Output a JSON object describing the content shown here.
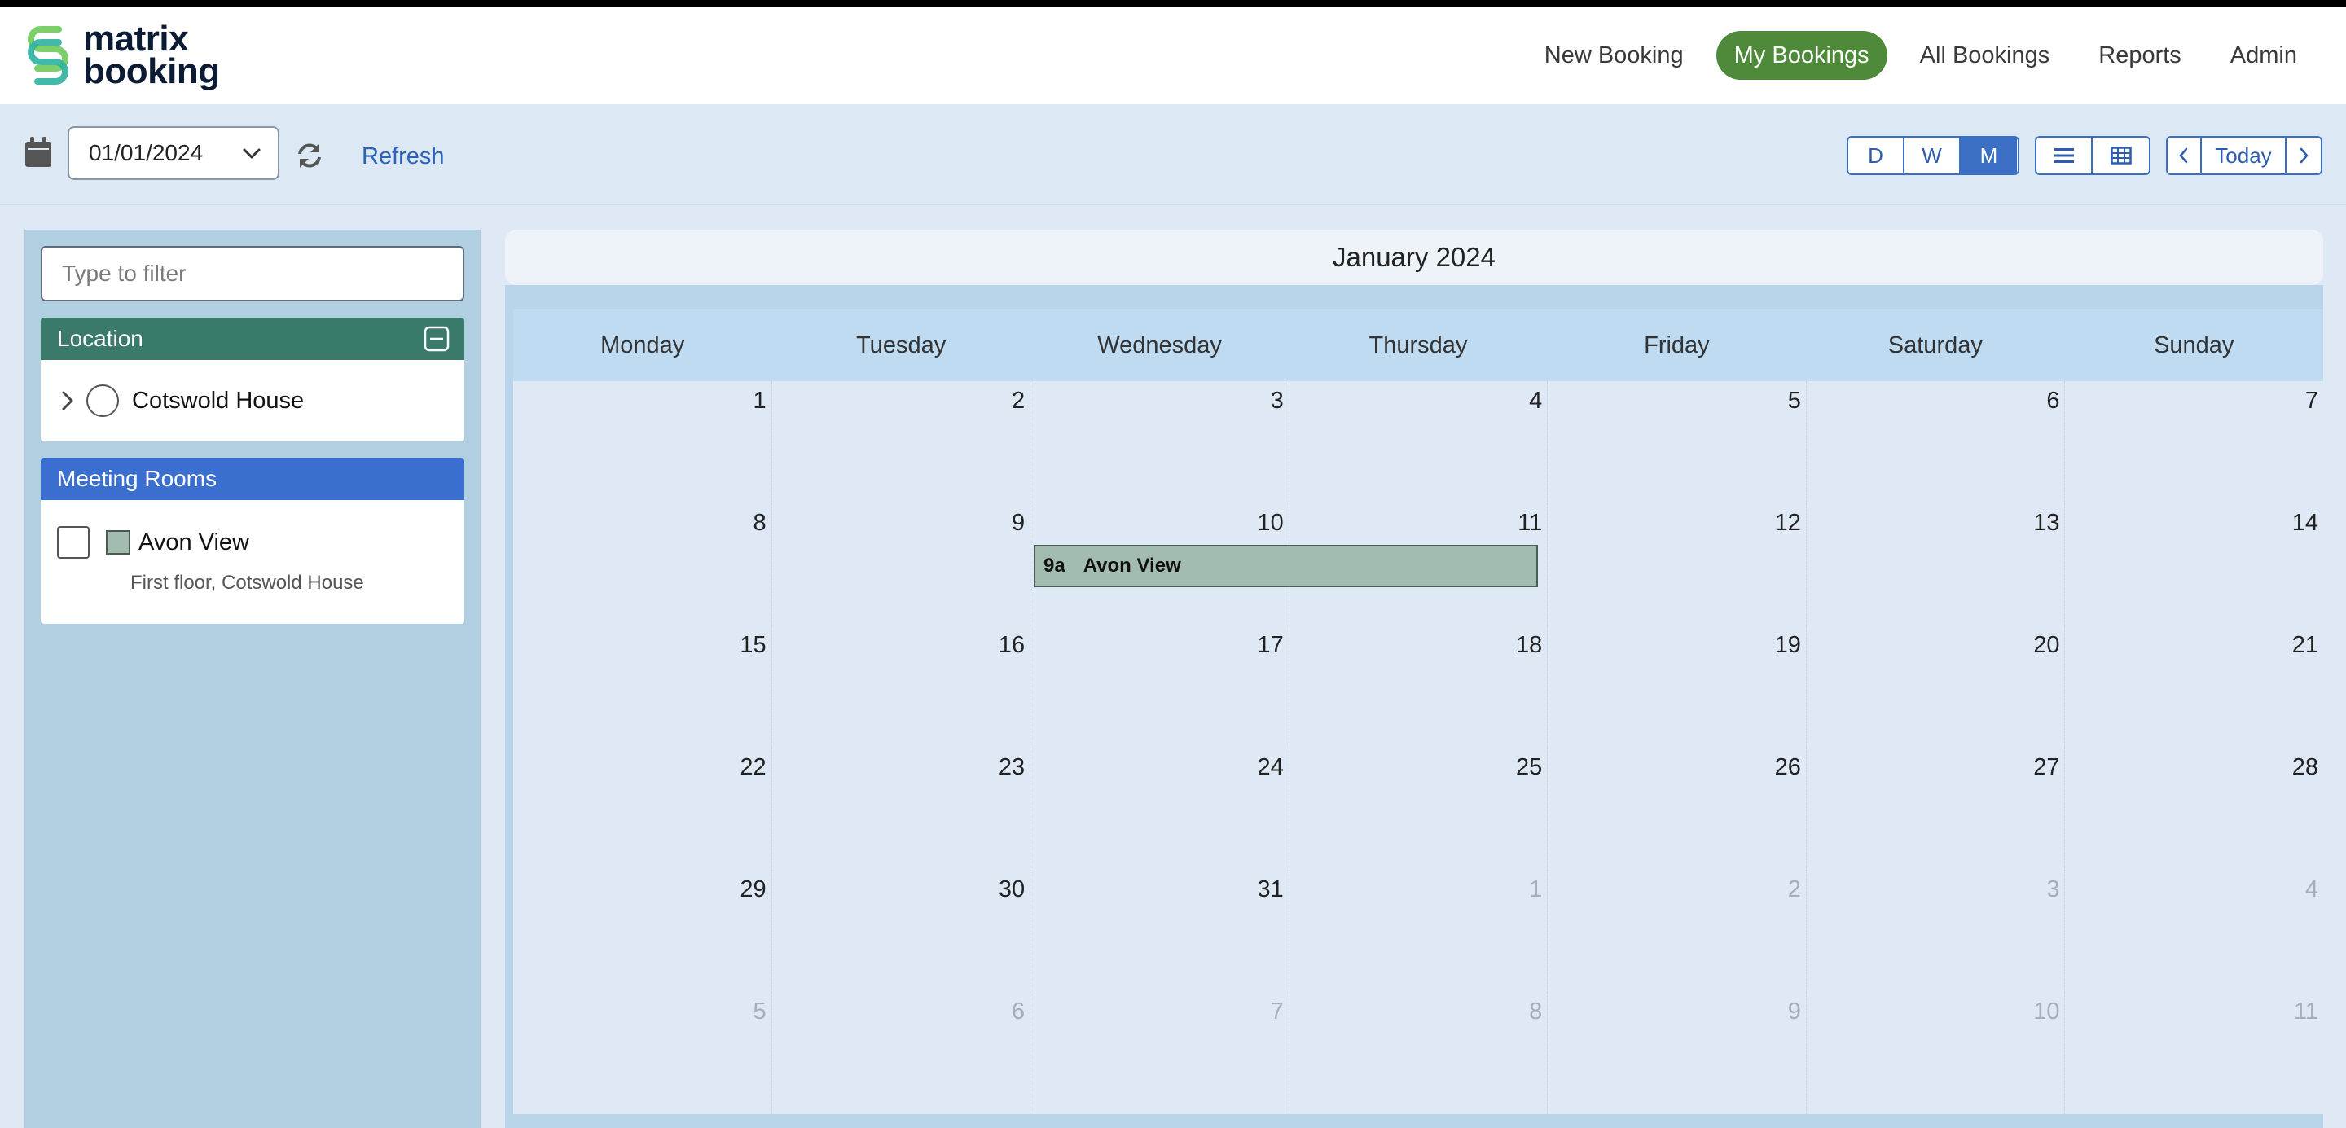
{
  "brand": {
    "line1": "matrix",
    "line2": "booking"
  },
  "nav": {
    "items": [
      {
        "label": "New Booking",
        "active": false
      },
      {
        "label": "My Bookings",
        "active": true
      },
      {
        "label": "All Bookings",
        "active": false
      },
      {
        "label": "Reports",
        "active": false
      },
      {
        "label": "Admin",
        "active": false
      }
    ]
  },
  "toolbar": {
    "date_value": "01/01/2024",
    "refresh_label": "Refresh",
    "view_modes": [
      "D",
      "W",
      "M"
    ],
    "active_view_mode": "M",
    "today_label": "Today"
  },
  "sidebar": {
    "filter_placeholder": "Type to filter",
    "location": {
      "title": "Location",
      "items": [
        {
          "label": "Cotswold House"
        }
      ]
    },
    "meeting_rooms": {
      "title": "Meeting Rooms",
      "items": [
        {
          "label": "Avon View",
          "subtitle": "First floor, Cotswold House",
          "color": "#a2bcaf"
        }
      ]
    }
  },
  "calendar": {
    "month_title": "January 2024",
    "weekdays": [
      "Monday",
      "Tuesday",
      "Wednesday",
      "Thursday",
      "Friday",
      "Saturday",
      "Sunday"
    ],
    "weeks": [
      [
        "1",
        "2",
        "3",
        "4",
        "5",
        "6",
        "7"
      ],
      [
        "8",
        "9",
        "10",
        "11",
        "12",
        "13",
        "14"
      ],
      [
        "15",
        "16",
        "17",
        "18",
        "19",
        "20",
        "21"
      ],
      [
        "22",
        "23",
        "24",
        "25",
        "26",
        "27",
        "28"
      ],
      [
        "29",
        "30",
        "31",
        "1",
        "2",
        "3",
        "4"
      ],
      [
        "5",
        "6",
        "7",
        "8",
        "9",
        "10",
        "11"
      ]
    ],
    "event": {
      "time": "9a",
      "title": "Avon View"
    }
  },
  "colors": {
    "active_nav": "#4f8a3a",
    "location_header": "#3a7a6a",
    "rooms_header": "#3a6fd0",
    "accent_blue": "#3a6fc4",
    "event_fill": "#a2bcaf"
  }
}
